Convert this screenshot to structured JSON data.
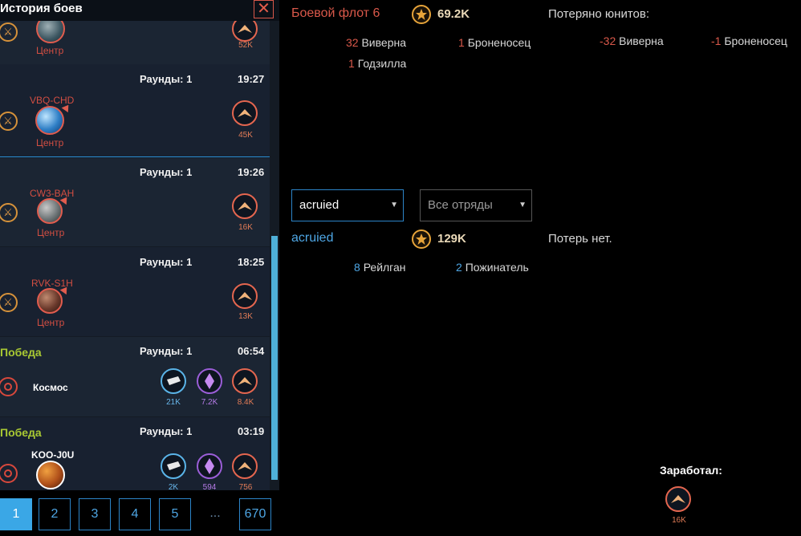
{
  "panel": {
    "title": "История боев",
    "close_label": "✕",
    "cards": [
      {
        "planet_sub": "Центр",
        "ore_value": "52K"
      },
      {
        "rounds": "Раунды: 1",
        "time": "19:27",
        "planet_code": "VBQ-CHD",
        "planet_sub": "Центр",
        "ore_value": "45K"
      },
      {
        "rounds": "Раунды: 1",
        "time": "19:26",
        "planet_code": "CW3-BAH",
        "planet_sub": "Центр",
        "ore_value": "16K"
      },
      {
        "rounds": "Раунды: 1",
        "time": "18:25",
        "planet_code": "RVK-S1H",
        "planet_sub": "Центр",
        "ore_value": "13K"
      },
      {
        "result": "Победа",
        "rounds": "Раунды: 1",
        "time": "06:54",
        "location": "Космос",
        "silver_value": "21K",
        "crystal_value": "7.2K",
        "ore_value": "8.4K"
      },
      {
        "result": "Победа",
        "rounds": "Раунды: 1",
        "time": "03:19",
        "planet_code": "KOO-J0U",
        "silver_value": "2K",
        "crystal_value": "594",
        "ore_value": "756"
      }
    ]
  },
  "pagination": {
    "pages": [
      "1",
      "2",
      "3",
      "4",
      "5",
      "...",
      "670"
    ],
    "active": "1"
  },
  "attacker": {
    "name": "Боевой флот 6",
    "power": "69.2K",
    "units": [
      {
        "count": "32",
        "name": "Виверна"
      },
      {
        "count": "1",
        "name": "Броненосец"
      },
      {
        "count": "1",
        "name": "Годзилла"
      }
    ],
    "losses_title": "Потеряно юнитов:",
    "losses": [
      {
        "count": "-32",
        "name": "Виверна"
      },
      {
        "count": "-1",
        "name": "Броненосец"
      }
    ]
  },
  "filters": {
    "player_select": "acruied",
    "squad_select": "Все отряды"
  },
  "defender": {
    "name": "acruied",
    "power": "129K",
    "units": [
      {
        "count": "8",
        "name": "Рейлган"
      },
      {
        "count": "2",
        "name": "Пожинатель"
      }
    ],
    "losses_text": "Потерь нет."
  },
  "earned": {
    "title": "Заработал:",
    "ore_value": "16K"
  },
  "colors": {
    "accent_blue": "#2c84c8",
    "enemy_red": "#d9584a",
    "victory_green": "#a9c933",
    "power_gold": "#e7a43a"
  }
}
